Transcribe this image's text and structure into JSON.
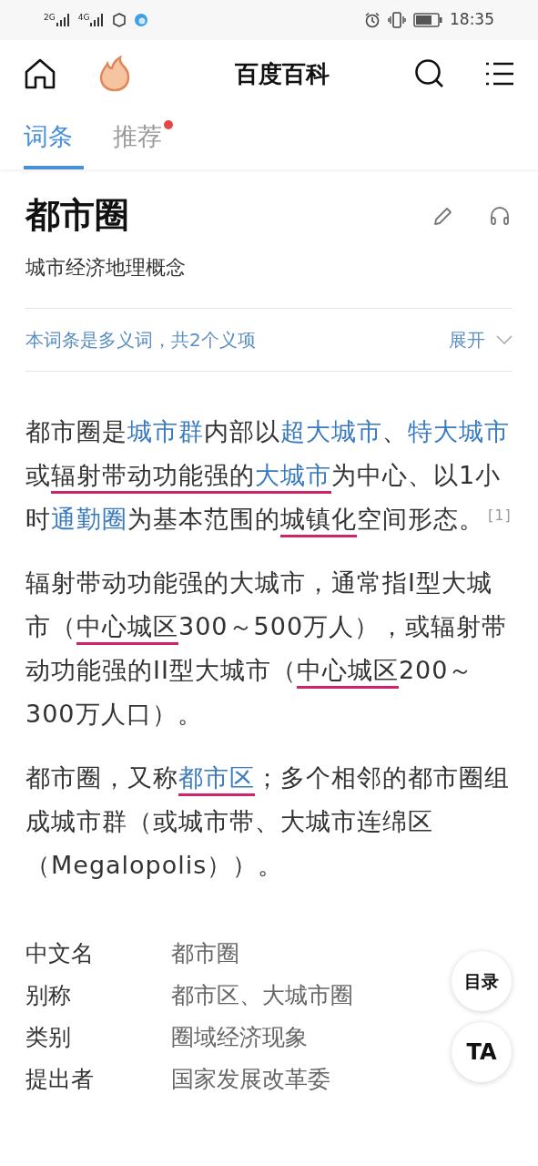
{
  "status_bar": {
    "signals": [
      "2G",
      "4G"
    ],
    "time": "18:35"
  },
  "header": {
    "title": "百度百科"
  },
  "tabs": [
    {
      "label": "词条",
      "selected": true,
      "dot": false
    },
    {
      "label": "推荐",
      "selected": false,
      "dot": true
    }
  ],
  "entry": {
    "title": "都市圈",
    "subtitle": "城市经济地理概念",
    "polysemy": {
      "text": "本词条是多义词，共2个义项",
      "toggle": "展开",
      "expanded": false
    }
  },
  "paragraphs": [
    [
      {
        "kind": "plain",
        "text": "都市圈是"
      },
      {
        "kind": "link",
        "text": "城市群"
      },
      {
        "kind": "plain",
        "text": "内部以"
      },
      {
        "kind": "link",
        "text": "超大城市"
      },
      {
        "kind": "plain",
        "text": "、"
      },
      {
        "kind": "link",
        "text": "特大城市"
      },
      {
        "kind": "plain",
        "text": "或"
      },
      {
        "kind": "plain",
        "text": "辐射带动功能强的",
        "underlined": true
      },
      {
        "kind": "link",
        "text": "大城市",
        "underlined": true
      },
      {
        "kind": "plain",
        "text": "为中心、以1小时"
      },
      {
        "kind": "link",
        "text": "通勤圈"
      },
      {
        "kind": "plain",
        "text": "为基本范围的"
      },
      {
        "kind": "plain",
        "text": "城镇化",
        "underlined": true
      },
      {
        "kind": "plain",
        "text": "空间形态。"
      },
      {
        "kind": "ref",
        "text": "[1]"
      }
    ],
    [
      {
        "kind": "plain",
        "text": "辐射带动功能强的大城市，通常指I型大城市（"
      },
      {
        "kind": "plain",
        "text": "中心城区",
        "underlined": true
      },
      {
        "kind": "plain",
        "text": "300～500万人），或辐射带动功能强的II型大城市（"
      },
      {
        "kind": "plain",
        "text": "中心城区",
        "underlined": true
      },
      {
        "kind": "plain",
        "text": "200～300万人口）。"
      }
    ],
    [
      {
        "kind": "plain",
        "text": "都市圈，又称"
      },
      {
        "kind": "link",
        "text": "都市区",
        "underlined": true
      },
      {
        "kind": "plain",
        "text": "；多个相邻的都市圈组成城市群（或城市带、大城市连绵区（Megalopolis））。"
      }
    ]
  ],
  "info": [
    {
      "label": "中文名",
      "value": "都市圈"
    },
    {
      "label": "别称",
      "value": "都市区、大城市圈"
    },
    {
      "label": "类别",
      "value": "圈域经济现象"
    },
    {
      "label": "提出者",
      "value": "国家发展改革委"
    }
  ],
  "floating": {
    "toc": "目录",
    "ta": "TA"
  }
}
